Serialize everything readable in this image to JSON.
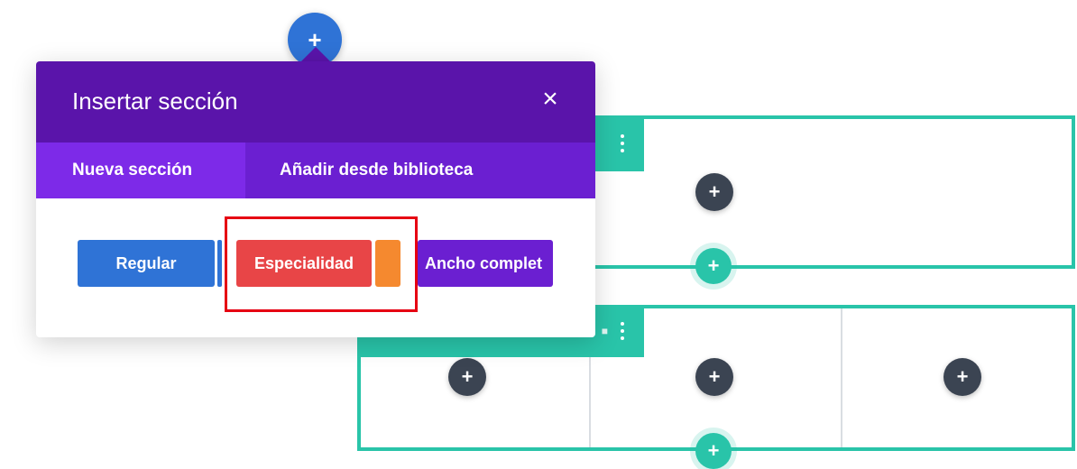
{
  "modal": {
    "title": "Insertar sección",
    "close_icon": "close-icon",
    "tabs": [
      {
        "label": "Nueva sección",
        "active": true
      },
      {
        "label": "Añadir desde biblioteca",
        "active": false
      }
    ],
    "buttons": {
      "regular": "Regular",
      "especialidad": "Especialidad",
      "ancho_completo": "Ancho complet"
    }
  },
  "add_button": "+",
  "colors": {
    "header": "#5a14aa",
    "tabs": "#6b1fd1",
    "active_tab": "#7d2ae8",
    "regular": "#2f73d6",
    "especialidad": "#e84547",
    "especialidad_secondary": "#f5892f",
    "ancho_completo": "#6b1fd1",
    "section_border": "#29c4a9",
    "module_add": "#3b4452",
    "highlight": "#e60012"
  }
}
